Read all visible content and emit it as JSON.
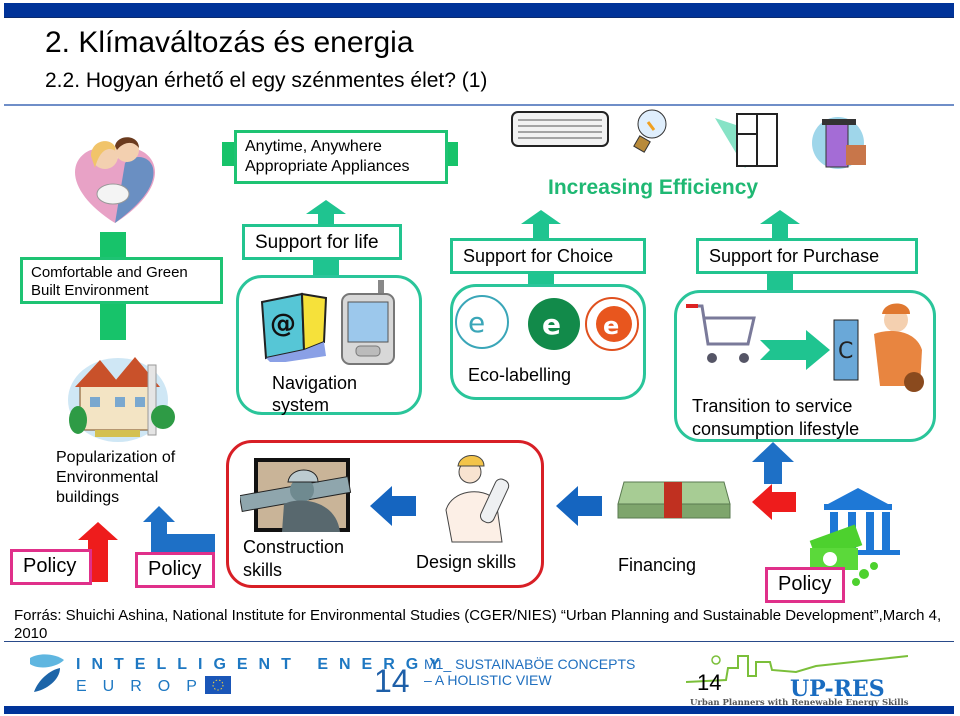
{
  "slide": {
    "title": "2. Klímaváltozás és energia",
    "subtitle": "2.2. Hogyan érhető el egy szénmentes élet? (1)"
  },
  "diagram": {
    "efficiency_label": "Increasing Efficiency",
    "appliances_box": "Anytime, Anywhere\nAppropriate Appliances",
    "comfortable_box": "Comfortable and Green\nBuilt Environment",
    "support_life": "Support for life",
    "support_choice": "Support for Choice",
    "support_purchase": "Support for Purchase",
    "navigation": "Navigation\nsystem",
    "eco_labelling": "Eco-labelling",
    "transition": "Transition to service\nconsumption lifestyle",
    "popularization": "Popularization of\nEnvironmental\nbuildings",
    "construction": "Construction\nskills",
    "design": "Design skills",
    "financing": "Financing",
    "policy_labels": [
      "Policy",
      "Policy",
      "Policy"
    ],
    "colors": {
      "green": "#1ec373",
      "teal": "#22c48f",
      "red": "#d81f26",
      "blue_arrow": "#1565c0",
      "policy_border": "#e0308a",
      "efficiency_text": "#1fb873"
    }
  },
  "footer": {
    "source": "Forrás: Shuichi Ashina, National Institute for Environmental Studies (CGER/NIES) “Urban Planning and Sustainable Development”,March 4, 2010",
    "iee_line1": "INTELLIGENT ENERGY",
    "iee_line2": "EUROPE",
    "page_number": "14",
    "module_title": "M1_ SUSTAINABÖE CONCEPTS\n– A HOLISTIC VIEW",
    "page_number_2": "14",
    "upres_logo": "UP-RES",
    "upres_tagline": "Urban Planners with Renewable Energy Skills"
  }
}
